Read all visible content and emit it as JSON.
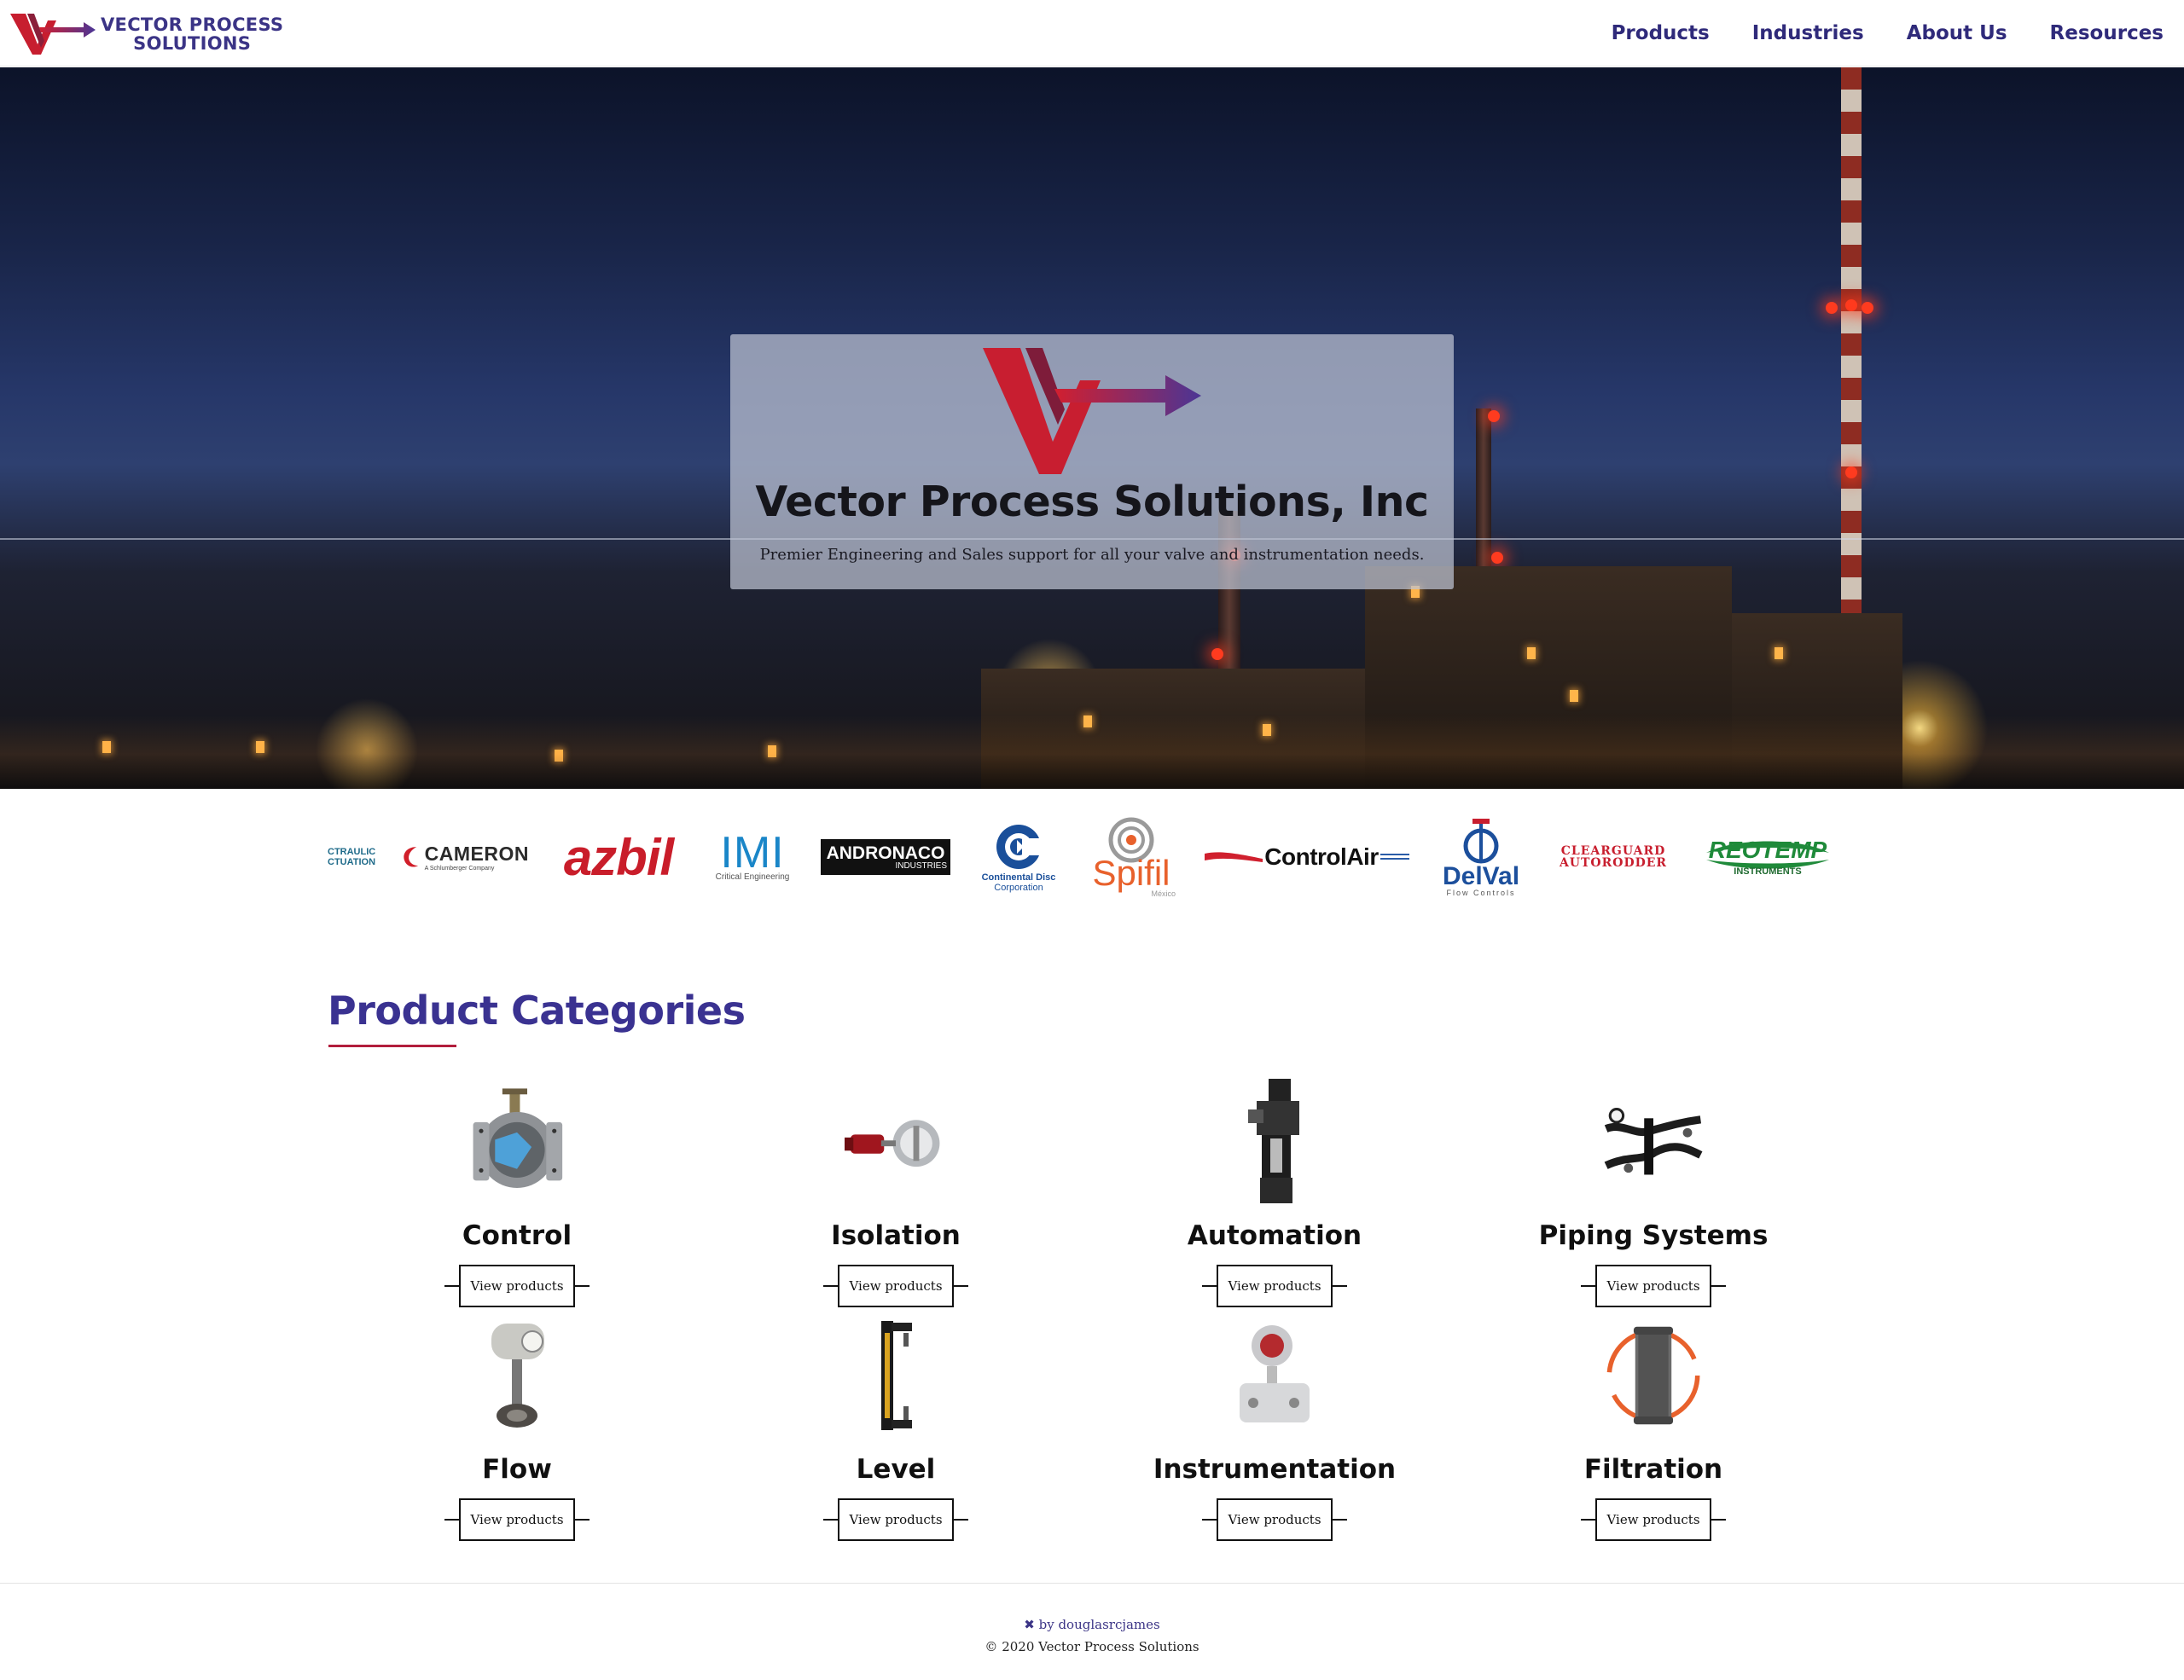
{
  "header": {
    "brand_line1": "VECTOR PROCESS",
    "brand_line2": "SOLUTIONS",
    "nav": [
      "Products",
      "Industries",
      "About Us",
      "Resources"
    ]
  },
  "hero": {
    "title": "Vector Process Solutions, Inc",
    "subtitle": "Premier Engineering and Sales support for all your valve and instrumentation needs."
  },
  "brands": {
    "hydraulic_line1": "CTRAULIC",
    "hydraulic_line2": "CTUATION",
    "cameron": "CAMERON",
    "cameron_sub": "A Schlumberger Company",
    "azbil": "azbil",
    "imi": "IMI",
    "imi_sub": "Critical Engineering",
    "andronaco": "ANDRONACO",
    "andronaco_sub": "INDUSTRIES",
    "continental_line1": "Continental Disc",
    "continental_line2": "Corporation",
    "spifil": "Spifil",
    "spifil_sub": "México",
    "controlair": "ControlAir",
    "delval": "DelVal",
    "delval_sub": "Flow Controls",
    "clearguard_line1": "CLEARGUARD",
    "clearguard_line2": "AUTORODDER",
    "reotemp": "REOTEMP",
    "reotemp_sub": "INSTRUMENTS"
  },
  "categories": {
    "heading": "Product Categories",
    "button_label": "View products",
    "items": [
      {
        "name": "Control"
      },
      {
        "name": "Isolation"
      },
      {
        "name": "Automation"
      },
      {
        "name": "Piping Systems"
      },
      {
        "name": "Flow"
      },
      {
        "name": "Level"
      },
      {
        "name": "Instrumentation"
      },
      {
        "name": "Filtration"
      }
    ]
  },
  "footer": {
    "credit": "by douglasrcjames",
    "copyright": "© 2020 Vector Process Solutions"
  },
  "colors": {
    "brand_purple": "#3a3291",
    "brand_red": "#c21e2e",
    "accent_underline": "#b21e3c"
  }
}
